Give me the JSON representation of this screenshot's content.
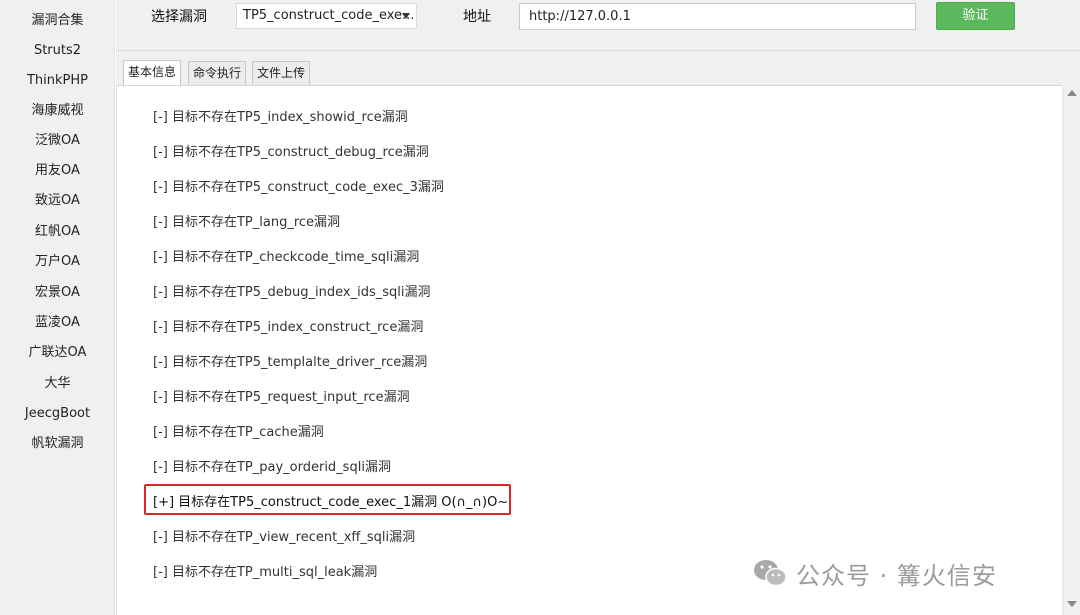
{
  "sidebar": {
    "items": [
      {
        "label": "漏洞合集"
      },
      {
        "label": "Struts2"
      },
      {
        "label": "ThinkPHP"
      },
      {
        "label": "海康威视"
      },
      {
        "label": "泛微OA"
      },
      {
        "label": "用友OA"
      },
      {
        "label": "致远OA"
      },
      {
        "label": "红帆OA"
      },
      {
        "label": "万户OA"
      },
      {
        "label": "宏景OA"
      },
      {
        "label": "蓝凌OA"
      },
      {
        "label": "广联达OA"
      },
      {
        "label": "大华"
      },
      {
        "label": "JeecgBoot"
      },
      {
        "label": "帆软漏洞"
      }
    ]
  },
  "toolbar": {
    "select_label": "选择漏洞",
    "select_value": "TP5_construct_code_exe...",
    "address_label": "地址",
    "address_value": "http://127.0.0.1",
    "verify_label": "验证"
  },
  "tabs": [
    {
      "label": "基本信息"
    },
    {
      "label": "命令执行"
    },
    {
      "label": "文件上传"
    }
  ],
  "results": [
    {
      "text": "[-] 目标不存在TP5_index_showid_rce漏洞"
    },
    {
      "text": "[-] 目标不存在TP5_construct_debug_rce漏洞"
    },
    {
      "text": "[-] 目标不存在TP5_construct_code_exec_3漏洞"
    },
    {
      "text": "[-] 目标不存在TP_lang_rce漏洞"
    },
    {
      "text": "[-] 目标不存在TP_checkcode_time_sqli漏洞"
    },
    {
      "text": "[-] 目标不存在TP5_debug_index_ids_sqli漏洞"
    },
    {
      "text": "[-] 目标不存在TP5_index_construct_rce漏洞"
    },
    {
      "text": "[-] 目标不存在TP5_templalte_driver_rce漏洞"
    },
    {
      "text": "[-] 目标不存在TP5_request_input_rce漏洞"
    },
    {
      "text": "[-] 目标不存在TP_cache漏洞"
    },
    {
      "text": "[-] 目标不存在TP_pay_orderid_sqli漏洞"
    },
    {
      "text": "[+] 目标存在TP5_construct_code_exec_1漏洞  O(∩_∩)O~"
    },
    {
      "text": "[-] 目标不存在TP_view_recent_xff_sqli漏洞"
    },
    {
      "text": "[-] 目标不存在TP_multi_sql_leak漏洞"
    }
  ],
  "watermark": {
    "text": "公众号 · 篝火信安",
    "icon": "wechat-icon"
  },
  "colors": {
    "accent_green": "#5cb85c",
    "highlight_red": "#e0252a"
  }
}
